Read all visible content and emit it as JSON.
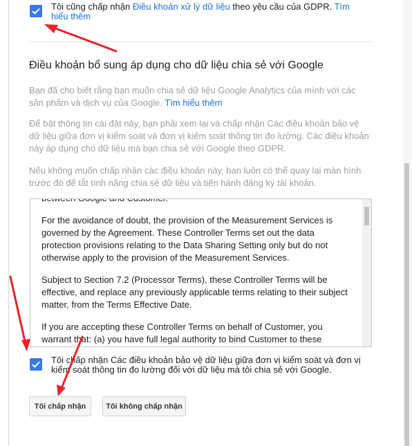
{
  "gdpr_checkbox": {
    "text_before": "Tôi cũng chấp nhận ",
    "link_text": "Điều khoản xử lý dữ liệu",
    "text_after": " theo yêu cầu của GDPR. ",
    "learn_more": "Tìm hiểu thêm",
    "checked": true
  },
  "section": {
    "title": "Điều khoản bổ sung áp dụng cho dữ liệu chia sẻ với Google",
    "para1": "Bạn đã cho biết rằng bạn muốn chia sẻ dữ liệu Google Analytics của mình với các sản phẩm và dịch vụ của Google. ",
    "para1_link": "Tìm hiểu thêm",
    "para2": "Để bật thông tin cài đặt này, bạn phải xem lại và chấp nhận Các điều khoản bảo vệ dữ liệu giữa đơn vị kiểm soát và đơn vị kiểm soát thông tin đo lường. Các điều khoản này áp dụng cho dữ liệu mà bạn chia sẻ với Google theo GDPR.",
    "para3": "Nếu không muốn chấp nhận các điều khoản này, bạn luôn có thể quay lại màn hình trước đó để tắt tính năng chia sẻ dữ liệu và tiến hành đăng ký tài khoản."
  },
  "terms": {
    "p0": "between Google and Customer.",
    "p1": "For the avoidance of doubt, the provision of the Measurement Services is governed by the Agreement. These Controller Terms set out the data protection provisions relating to the Data Sharing Setting only but do not otherwise apply to the provision of the Measurement Services.",
    "p2": "Subject to Section 7.2 (Processor Terms), these Controller Terms will be effective, and replace any previously applicable terms relating to their subject matter, from the Terms Effective Date.",
    "p3": "If you are accepting these Controller Terms on behalf of Customer, you warrant that: (a) you have full legal authority to bind Customer to these"
  },
  "controller_checkbox": {
    "text": "Tôi chấp nhận Các điều khoản bảo vệ dữ liệu giữa đơn vị kiểm soát và đơn vị kiểm soát thông tin đo lường đối với dữ liệu mà tôi chia sẻ với Google.",
    "checked": true
  },
  "buttons": {
    "accept": "Tôi chấp nhận",
    "decline": "Tôi không chấp nhận"
  },
  "colors": {
    "checkbox": "#3b78e7",
    "link": "#1a73e8",
    "arrow": "#e8232b"
  }
}
